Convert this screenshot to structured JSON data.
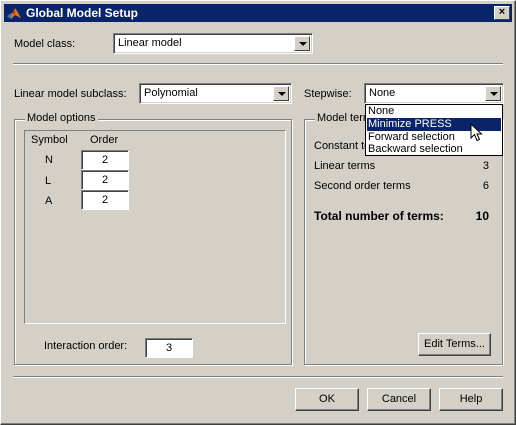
{
  "window": {
    "title": "Global Model Setup",
    "close_glyph": "×",
    "icon": "matlab-logo-icon"
  },
  "model_class": {
    "label": "Model class:",
    "value": "Linear model"
  },
  "subclass": {
    "label": "Linear model subclass:",
    "value": "Polynomial"
  },
  "stepwise": {
    "label": "Stepwise:",
    "value": "None",
    "options": [
      "None",
      "Minimize PRESS",
      "Forward selection",
      "Backward selection"
    ],
    "highlighted": "Minimize PRESS"
  },
  "model_options": {
    "title": "Model options",
    "col_symbol": "Symbol",
    "col_order": "Order",
    "rows": [
      {
        "symbol": "N",
        "order": "2"
      },
      {
        "symbol": "L",
        "order": "2"
      },
      {
        "symbol": "A",
        "order": "2"
      }
    ],
    "interaction_label": "Interaction order:",
    "interaction_value": "3"
  },
  "model_terms": {
    "title": "Model terms",
    "constant_label": "Constant term",
    "linear_label": "Linear terms",
    "linear_value": "3",
    "second_label": "Second order terms",
    "second_value": "6",
    "total_label": "Total number of terms:",
    "total_value": "10",
    "edit_button": "Edit Terms..."
  },
  "buttons": {
    "ok": "OK",
    "cancel": "Cancel",
    "help": "Help"
  },
  "colors": {
    "face": "#d4d0c8",
    "titlebar": "#0a246a",
    "selection": "#0a246a"
  }
}
